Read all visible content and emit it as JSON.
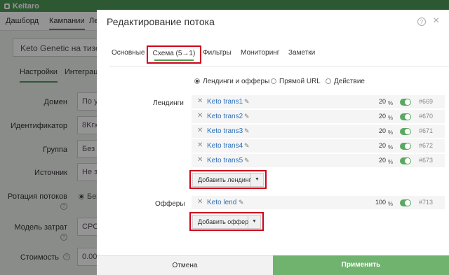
{
  "app": {
    "brand": "Keitaro"
  },
  "nav": {
    "items": [
      "Дашборд",
      "Кампании",
      "Ле"
    ]
  },
  "campaign": {
    "name": "Keto Genetic на тизер"
  },
  "subtabs": [
    "Настройки",
    "Интеграци"
  ],
  "form": {
    "rows": [
      {
        "label": "Домен",
        "value": "По у"
      },
      {
        "label": "Идентификатор",
        "value": "8Krx"
      },
      {
        "label": "Группа",
        "value": "Без г"
      },
      {
        "label": "Источник",
        "value": "Не за"
      },
      {
        "label": "Ротация потоков",
        "value": "Без"
      },
      {
        "label": "Модель затрат",
        "value": "CPC"
      },
      {
        "label": "Стоимость",
        "value": "0.00"
      }
    ]
  },
  "modal": {
    "title": "Редактирование потока",
    "help_icon": "question-circle-icon",
    "close_icon": "close-icon",
    "tabs": [
      "Основные",
      "Схема (5→1)",
      "Фильтры",
      "Мониторинг",
      "Заметки"
    ],
    "active_tab": "Схема (5→1)",
    "schema_options": [
      "Лендинги и офферы",
      "Прямой URL",
      "Действие"
    ],
    "selected_schema": "Лендинги и офферы",
    "landings_label": "Лендинги",
    "landings": [
      {
        "name": "Keto trans1",
        "weight": "20",
        "id": "#669",
        "enabled": true
      },
      {
        "name": "Keto trans2",
        "weight": "20",
        "id": "#670",
        "enabled": true
      },
      {
        "name": "Keto trans3",
        "weight": "20",
        "id": "#671",
        "enabled": true
      },
      {
        "name": "Keto trans4",
        "weight": "20",
        "id": "#672",
        "enabled": true
      },
      {
        "name": "Keto trans5",
        "weight": "20",
        "id": "#673",
        "enabled": true
      }
    ],
    "add_landings": "Добавить лендинги",
    "offers_label": "Офферы",
    "offers": [
      {
        "name": "Keto lend",
        "weight": "100",
        "id": "#713",
        "enabled": true
      }
    ],
    "add_offers": "Добавить офферы",
    "percent_sign": "%",
    "cancel": "Отмена",
    "apply": "Применить"
  },
  "colors": {
    "brand": "#4e9a56",
    "apply": "#6fb36f",
    "highlight": "#d0021b",
    "link": "#2e6fb6"
  }
}
